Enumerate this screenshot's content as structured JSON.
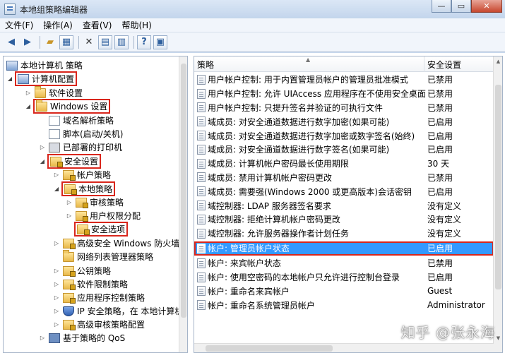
{
  "window": {
    "title": "本地组策略编辑器"
  },
  "menu": [
    "文件(F)",
    "操作(A)",
    "查看(V)",
    "帮助(H)"
  ],
  "tree": [
    {
      "label": "本地计算机 策略",
      "icon": "computer-icon",
      "exp": ""
    },
    {
      "label": "计算机配置",
      "icon": "computer-icon",
      "exp": "◢"
    },
    {
      "label": "软件设置",
      "icon": "folder-icon",
      "exp": "▷"
    },
    {
      "label": "Windows 设置",
      "icon": "folder-icon",
      "exp": "◢"
    },
    {
      "label": "域名解析策略",
      "icon": "doc-icon",
      "exp": ""
    },
    {
      "label": "脚本(启动/关机)",
      "icon": "doc-icon",
      "exp": ""
    },
    {
      "label": "已部署的打印机",
      "icon": "printer-icon",
      "exp": "▷"
    },
    {
      "label": "安全设置",
      "icon": "lock-folder-icon",
      "exp": "◢"
    },
    {
      "label": "帐户策略",
      "icon": "lock-folder-icon",
      "exp": "▷"
    },
    {
      "label": "本地策略",
      "icon": "lock-folder-icon",
      "exp": "◢"
    },
    {
      "label": "审核策略",
      "icon": "lock-folder-icon",
      "exp": "▷"
    },
    {
      "label": "用户权限分配",
      "icon": "lock-folder-icon",
      "exp": "▷"
    },
    {
      "label": "安全选项",
      "icon": "lock-folder-icon",
      "exp": ""
    },
    {
      "label": "高级安全 Windows 防火墙",
      "icon": "lock-folder-icon",
      "exp": "▷"
    },
    {
      "label": "网络列表管理器策略",
      "icon": "folder-icon",
      "exp": ""
    },
    {
      "label": "公钥策略",
      "icon": "lock-folder-icon",
      "exp": "▷"
    },
    {
      "label": "软件限制策略",
      "icon": "lock-folder-icon",
      "exp": "▷"
    },
    {
      "label": "应用程序控制策略",
      "icon": "lock-folder-icon",
      "exp": "▷"
    },
    {
      "label": "IP 安全策略，在 本地计算机",
      "icon": "shield-icon",
      "exp": "▷"
    },
    {
      "label": "高级审核策略配置",
      "icon": "lock-folder-icon",
      "exp": "▷"
    },
    {
      "label": "基于策略的 QoS",
      "icon": "monitor-icon",
      "exp": "▷"
    }
  ],
  "columns": {
    "policy": "策略",
    "setting": "安全设置"
  },
  "rows": [
    {
      "policy": "用户帐户控制: 用于内置管理员帐户的管理员批准模式",
      "setting": "已禁用"
    },
    {
      "policy": "用户帐户控制: 允许 UIAccess 应用程序在不使用安全桌面...",
      "setting": "已禁用"
    },
    {
      "policy": "用户帐户控制: 只提升签名并验证的可执行文件",
      "setting": "已禁用"
    },
    {
      "policy": "域成员: 对安全通道数据进行数字加密(如果可能)",
      "setting": "已启用"
    },
    {
      "policy": "域成员: 对安全通道数据进行数字加密或数字签名(始终)",
      "setting": "已启用"
    },
    {
      "policy": "域成员: 对安全通道数据进行数字签名(如果可能)",
      "setting": "已启用"
    },
    {
      "policy": "域成员: 计算机帐户密码最长使用期限",
      "setting": "30 天"
    },
    {
      "policy": "域成员: 禁用计算机帐户密码更改",
      "setting": "已禁用"
    },
    {
      "policy": "域成员: 需要强(Windows 2000 或更高版本)会话密钥",
      "setting": "已启用"
    },
    {
      "policy": "域控制器: LDAP 服务器签名要求",
      "setting": "没有定义"
    },
    {
      "policy": "域控制器: 拒绝计算机帐户密码更改",
      "setting": "没有定义"
    },
    {
      "policy": "域控制器: 允许服务器操作者计划任务",
      "setting": "没有定义"
    },
    {
      "policy": "帐户: 管理员帐户状态",
      "setting": "已启用"
    },
    {
      "policy": "帐户: 来宾帐户状态",
      "setting": "已禁用"
    },
    {
      "policy": "帐户: 使用空密码的本地帐户只允许进行控制台登录",
      "setting": "已启用"
    },
    {
      "policy": "帐户: 重命名来宾帐户",
      "setting": "Guest"
    },
    {
      "policy": "帐户: 重命名系统管理员帐户",
      "setting": "Administrator"
    }
  ],
  "watermark": "知乎 @张永海"
}
